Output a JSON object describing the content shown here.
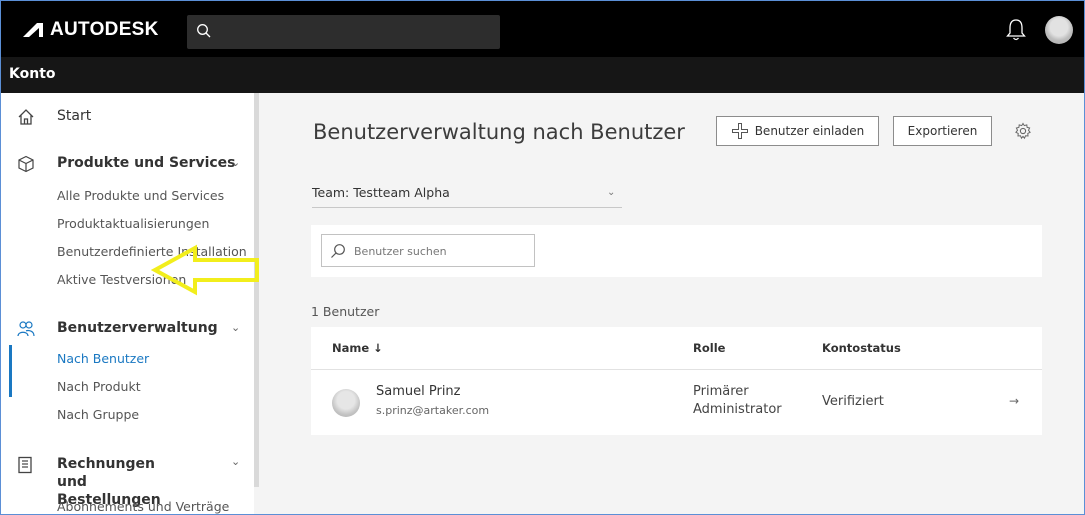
{
  "brand": {
    "name": "AUTODESK"
  },
  "header": {
    "account_title": "Konto"
  },
  "sidebar": {
    "start": "Start",
    "products": {
      "title": "Produkte und Services",
      "items": [
        "Alle Produkte und Services",
        "Produktaktualisierungen",
        "Benutzerdefinierte Installation",
        "Aktive Testversionen"
      ]
    },
    "users": {
      "title": "Benutzerverwaltung",
      "items": [
        "Nach Benutzer",
        "Nach Produkt",
        "Nach Gruppe"
      ],
      "active_index": 0
    },
    "billing": {
      "title": "Rechnungen und Bestellungen",
      "items": [
        "Abonnements und Verträge"
      ]
    }
  },
  "main": {
    "title": "Benutzerverwaltung nach Benutzer",
    "invite_button": "Benutzer einladen",
    "export_button": "Exportieren",
    "team_label": "Team:",
    "team_value": "Testteam Alpha",
    "search_placeholder": "Benutzer suchen",
    "count": "1 Benutzer",
    "table": {
      "columns": [
        "Name ↓",
        "Rolle",
        "Kontostatus"
      ],
      "rows": [
        {
          "name": "Samuel Prinz",
          "email": "s.prinz@artaker.com",
          "role": "Primärer Administrator",
          "status": "Verifiziert",
          "arrow": "→"
        }
      ]
    }
  },
  "colors": {
    "accent": "#1a78c2",
    "annotation": "#f2ee1c",
    "topbar": "#000000"
  },
  "icons": [
    "autodesk-logo-icon",
    "search-icon",
    "bell-icon",
    "avatar",
    "home-icon",
    "box-icon",
    "users-icon",
    "invoice-icon",
    "plus-icon",
    "gear-icon"
  ]
}
